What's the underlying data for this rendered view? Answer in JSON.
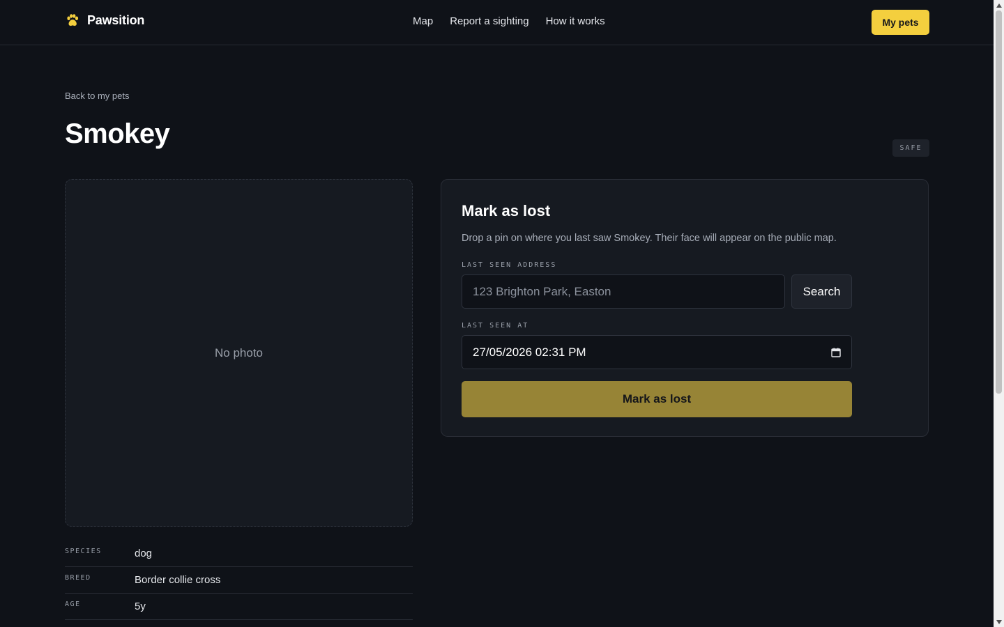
{
  "header": {
    "brand": "Pawsition",
    "nav": [
      "Map",
      "Report a sighting",
      "How it works"
    ],
    "my_pets_label": "My pets"
  },
  "page": {
    "back_label": "Back to my pets",
    "pet_name": "Smokey",
    "status": "SAFE"
  },
  "photo": {
    "placeholder": "No photo"
  },
  "details": [
    {
      "label": "SPECIES",
      "value": "dog"
    },
    {
      "label": "BREED",
      "value": "Border collie cross"
    },
    {
      "label": "AGE",
      "value": "5y"
    }
  ],
  "lost_panel": {
    "title": "Mark as lost",
    "description": "Drop a pin on where you last saw Smokey. Their face will appear on the public map.",
    "address_label": "LAST SEEN ADDRESS",
    "address_placeholder": "123 Brighton Park, Easton",
    "search_label": "Search",
    "time_label": "LAST SEEN AT",
    "time_value": "27/05/2026 02:31 PM",
    "submit_label": "Mark as lost"
  },
  "colors": {
    "background": "#0f1218",
    "panel": "#161a21",
    "accent": "#f4cf3e",
    "accent_muted": "#978436"
  },
  "icons": {
    "brand": "paw-icon",
    "date": "calendar-icon"
  }
}
